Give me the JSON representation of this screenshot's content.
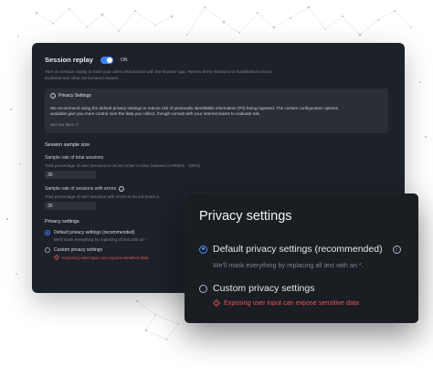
{
  "session_replay": {
    "title": "Session replay",
    "toggle_label": "ON",
    "description": "Turn on session replay to track your users interactions with the browser app. Review these sessions to troubleshoot errors, incidents and other performance issues.",
    "privacy_notice": {
      "title": "Privacy Settings",
      "body": "We recommend using the default privacy settings to reduce risk of personally identifiable information (PII) being ingested. The custom configuration options available give you more control over the data you collect, though consult with your internal teams to evaluate risk.",
      "link": "See our docs ↗"
    },
    "sample_size": {
      "heading": "Session sample size",
      "total": {
        "label": "Sample rate of total sessions",
        "hint": "Total percentage of user sessions to record (enter a value between 0.000001 - 100%)",
        "value": "30"
      },
      "errors": {
        "label": "Sample rate of sessions with errors",
        "hint": "Total percentage of user sessions with errors to record (enter a",
        "value": "30"
      }
    },
    "privacy": {
      "heading": "Privacy settings",
      "default_label": "Default privacy settings (recommended)",
      "default_sub": "We'll mask everything by replacing all text with an *.",
      "custom_label": "Custom privacy settings",
      "custom_warning": "Exposing user input can expose sensitive data"
    }
  },
  "privacy_card": {
    "title": "Privacy settings",
    "default_label": "Default privacy settings (recommended)",
    "default_sub": "We'll mask everything by replacing all text with an *.",
    "custom_label": "Custom privacy settings",
    "custom_warning": "Exposing user input can expose sensitive data"
  },
  "colors": {
    "accent": "#3b82f6",
    "warning": "#e8555a",
    "panel_bg": "#1d2128",
    "card_bg": "#1a1d22"
  },
  "icons": [
    "toggle-switch",
    "info-icon",
    "external-link-icon",
    "radio-icon",
    "warning-diamond-icon"
  ]
}
